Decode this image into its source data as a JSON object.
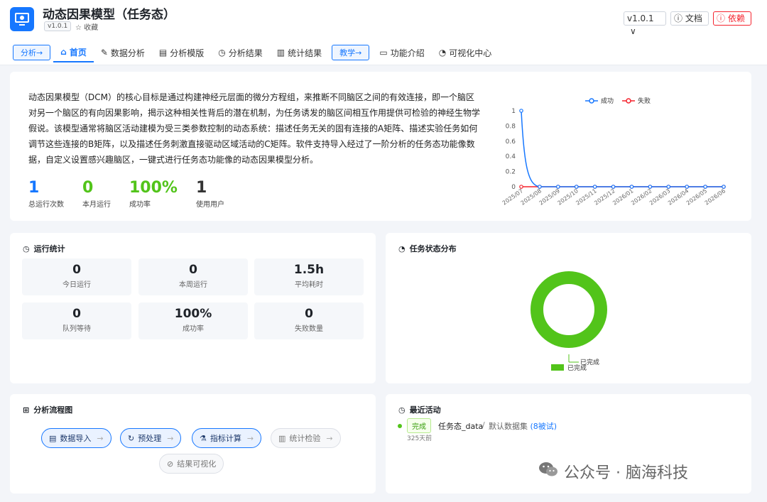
{
  "app": {
    "title": "动态因果模型（任务态）",
    "version_chip": "v1.0.1",
    "favorite": "☆ 收藏",
    "version_select": "v1.0.1",
    "doc_label": "文档",
    "dep_label": "依赖"
  },
  "nav": {
    "analysis_pill": "分析→",
    "home": "首页",
    "data_analysis": "数据分析",
    "template": "分析模版",
    "results": "分析结果",
    "stats_results": "统计结果",
    "teach_pill": "教学→",
    "features": "功能介绍",
    "viz_center": "可视化中心"
  },
  "intro": {
    "text": "动态因果模型（DCM）的核心目标是通过构建神经元层面的微分方程组，来推断不同脑区之间的有效连接，即一个脑区对另一个脑区的有向因果影响，揭示这种相关性背后的潜在机制，为任务诱发的脑区间相互作用提供可检验的神经生物学假说。该模型通常将脑区活动建模为受三类参数控制的动态系统：描述任务无关的固有连接的A矩阵、描述实验任务如何调节这些连接的B矩阵，以及描述任务刺激直接驱动区域活动的C矩阵。软件支持导入经过了一阶分析的任务态功能像数据，自定义设置感兴趣脑区，一键式进行任务态功能像的动态因果模型分析。",
    "kpis": [
      {
        "value": "1",
        "label": "总运行次数",
        "color": "#1677ff"
      },
      {
        "value": "0",
        "label": "本月运行",
        "color": "#52c41a"
      },
      {
        "value": "100%",
        "label": "成功率",
        "color": "#52c41a"
      },
      {
        "value": "1",
        "label": "使用用户",
        "color": "#333333"
      }
    ]
  },
  "chart_data": {
    "type": "line",
    "categories": [
      "2025/07",
      "2025/08",
      "2025/09",
      "2025/10",
      "2025/11",
      "2025/12",
      "2026/01",
      "2026/02",
      "2026/03",
      "2026/04",
      "2026/05",
      "2026/06"
    ],
    "series": [
      {
        "name": "成功",
        "values": [
          1,
          0,
          0,
          0,
          0,
          0,
          0,
          0,
          0,
          0,
          0,
          0
        ],
        "color": "#1677ff"
      },
      {
        "name": "失败",
        "values": [
          0,
          0,
          0,
          0,
          0,
          0,
          0,
          0,
          0,
          0,
          0,
          0
        ],
        "color": "#f5222d"
      }
    ],
    "yticks": [
      "0",
      "0.2",
      "0.4",
      "0.6",
      "0.8",
      "1"
    ],
    "ylim": [
      0,
      1
    ],
    "legend": "top-center"
  },
  "stats": {
    "title": "运行统计",
    "items": [
      {
        "value": "0",
        "label": "今日运行"
      },
      {
        "value": "0",
        "label": "本周运行"
      },
      {
        "value": "1.5h",
        "label": "平均耗时"
      },
      {
        "value": "0",
        "label": "队列等待"
      },
      {
        "value": "100%",
        "label": "成功率"
      },
      {
        "value": "0",
        "label": "失败数量"
      }
    ]
  },
  "status": {
    "title": "任务状态分布",
    "donut": {
      "completed_fraction": 1.0,
      "color": "#52c41a"
    },
    "slice_label": "已完成",
    "legend_label": "已完成"
  },
  "flow": {
    "title": "分析流程图",
    "steps": [
      {
        "label": "数据导入",
        "icon": "list-icon"
      },
      {
        "label": "预处理",
        "icon": "refresh-icon"
      },
      {
        "label": "指标计算",
        "icon": "flask-icon"
      },
      {
        "label": "统计检验",
        "icon": "bar-chart-icon"
      },
      {
        "label": "结果可视化",
        "icon": "check-circle-icon"
      }
    ],
    "arrow": "→"
  },
  "recent": {
    "title": "最近活动",
    "tag": "完成",
    "name": "任务态_data",
    "sep": "/",
    "dataset": "默认数据集",
    "subjects": "(8被试)",
    "time": "325天前"
  },
  "watermark": "公众号 · 脑海科技"
}
